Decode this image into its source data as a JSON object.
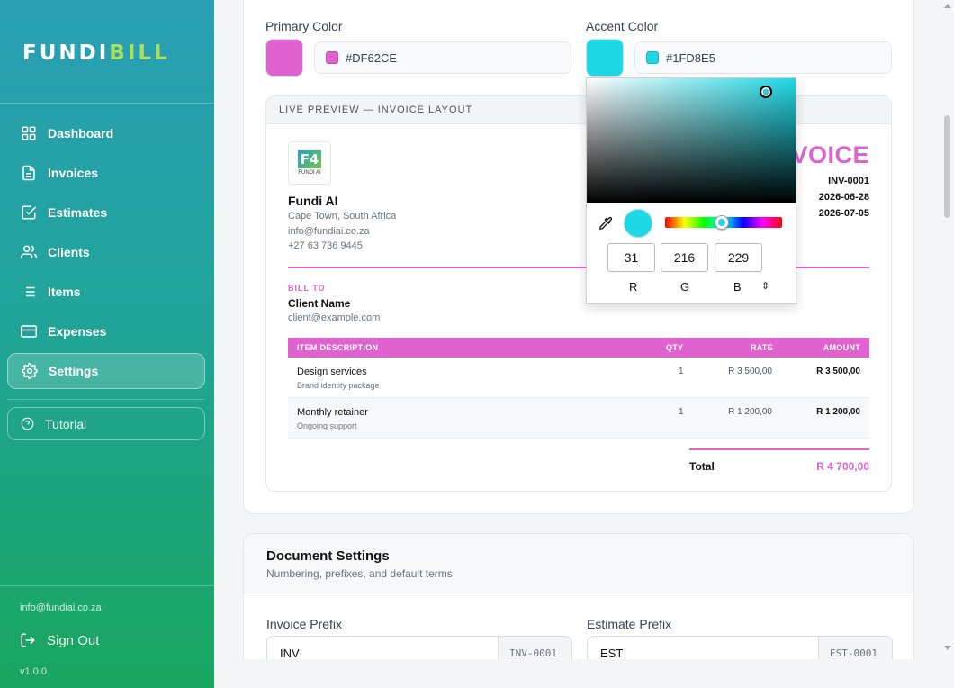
{
  "sidebar": {
    "logo": {
      "part1": "FUNDI",
      "part2": "BILL"
    },
    "items": [
      {
        "label": "Dashboard",
        "icon": "grid-icon"
      },
      {
        "label": "Invoices",
        "icon": "file-icon"
      },
      {
        "label": "Estimates",
        "icon": "check-square-icon"
      },
      {
        "label": "Clients",
        "icon": "users-icon"
      },
      {
        "label": "Items",
        "icon": "list-icon"
      },
      {
        "label": "Expenses",
        "icon": "credit-card-icon"
      },
      {
        "label": "Settings",
        "icon": "gear-icon",
        "active": true
      }
    ],
    "tutorial": "Tutorial",
    "email": "info@fundiai.co.za",
    "sign_out": "Sign Out",
    "version": "v1.0.0"
  },
  "branding": {
    "primary_label": "Primary Color",
    "primary_hex": "#DF62CE",
    "accent_label": "Accent Color",
    "accent_hex": "#1FD8E5"
  },
  "preview": {
    "header": "LIVE PREVIEW — INVOICE LAYOUT",
    "logo_text": "FUNDI AI",
    "company": "Fundi AI",
    "address": "Cape Town, South Africa",
    "email": "info@fundiai.co.za",
    "phone": "+27 63 736 9445",
    "title_visible": "VOICE",
    "number": "INV-0001",
    "date": "2026-06-28",
    "due": "2026-07-05",
    "bill_to_label": "BILL TO",
    "client_name": "Client Name",
    "client_email": "client@example.com",
    "columns": {
      "desc": "ITEM DESCRIPTION",
      "qty": "QTY",
      "rate": "RATE",
      "amount": "AMOUNT"
    },
    "rows": [
      {
        "desc": "Design services",
        "sub": "Brand identity package",
        "qty": "1",
        "rate": "R 3 500,00",
        "amount": "R 3 500,00"
      },
      {
        "desc": "Monthly retainer",
        "sub": "Ongoing support",
        "qty": "1",
        "rate": "R 1 200,00",
        "amount": "R 1 200,00"
      }
    ],
    "total_label": "Total",
    "total_value": "R 4 700,00"
  },
  "picker": {
    "r": "31",
    "g": "216",
    "b": "229",
    "r_label": "R",
    "g_label": "G",
    "b_label": "B",
    "mode_toggle": "⇕",
    "hue_fraction": 0.51
  },
  "document_settings": {
    "title": "Document Settings",
    "subtitle": "Numbering, prefixes, and default terms",
    "invoice_prefix_label": "Invoice Prefix",
    "invoice_prefix_value": "INV",
    "invoice_sample": "INV-0001",
    "estimate_prefix_label": "Estimate Prefix",
    "estimate_prefix_value": "EST",
    "estimate_sample": "EST-0001"
  }
}
